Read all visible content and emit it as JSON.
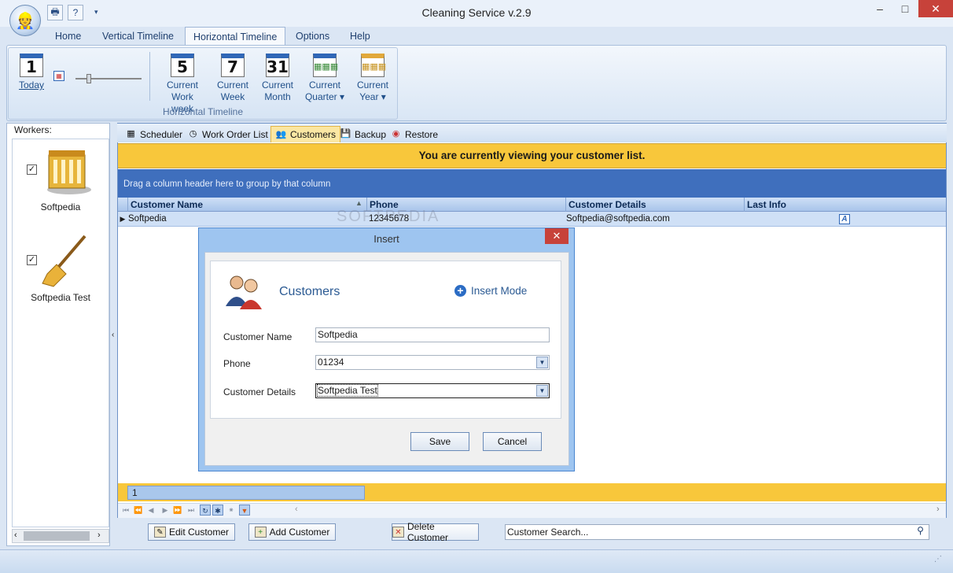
{
  "window": {
    "title": "Cleaning Service v.2.9",
    "minimize": "–",
    "maximize": "□",
    "close": "✕"
  },
  "menu": [
    "Home",
    "Vertical Timeline",
    "Horizontal Timeline",
    "Options",
    "Help"
  ],
  "ribbon": {
    "today": {
      "num": "1",
      "label": "Today"
    },
    "buttons": [
      {
        "num": "5",
        "line1": "Current",
        "line2": "Work week"
      },
      {
        "num": "7",
        "line1": "Current",
        "line2": "Week"
      },
      {
        "num": "31",
        "line1": "Current",
        "line2": "Month"
      },
      {
        "num": "",
        "line1": "Current",
        "line2": "Quarter ▾"
      },
      {
        "num": "",
        "line1": "Current",
        "line2": "Year ▾"
      }
    ],
    "group_label": "Horizontal Timeline"
  },
  "workers": {
    "label": "Workers:",
    "items": [
      {
        "name": "Softpedia",
        "checked": "✓"
      },
      {
        "name": "Softpedia Test",
        "checked": "✓"
      }
    ]
  },
  "tabs": [
    "Scheduler",
    "Work Order List",
    "Customers",
    "Backup",
    "Restore"
  ],
  "banner": "You are currently viewing your customer list.",
  "group_panel": "Drag a column header here to group by that column",
  "grid": {
    "columns": [
      "Customer Name",
      "Phone",
      "Customer Details",
      "Last Info"
    ],
    "rows": [
      {
        "name": "Softpedia",
        "phone": "12345678",
        "details": "Softpedia@softpedia.com",
        "last": "A"
      }
    ],
    "footer_value": "1"
  },
  "watermark": "SOFTPEDIA",
  "bottom": {
    "edit": "Edit Customer",
    "add": "Add Customer",
    "delete": "Delete Customer",
    "search": "Customer Search..."
  },
  "dialog": {
    "title": "Insert",
    "heading": "Customers",
    "mode": "Insert Mode",
    "fields": [
      {
        "label": "Customer Name",
        "value": "Softpedia"
      },
      {
        "label": "Phone",
        "value": "01234"
      },
      {
        "label": "Customer Details",
        "value": "Softpedia Test"
      }
    ],
    "save": "Save",
    "cancel": "Cancel"
  },
  "colors": {
    "accent": "#3f6fbd",
    "banner": "#f8c73b",
    "close": "#c7423a"
  }
}
